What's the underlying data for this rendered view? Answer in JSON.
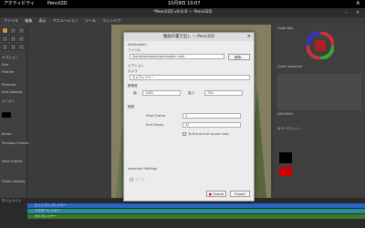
{
  "topbar": {
    "activities": "アクティビティ",
    "app": "Pencil2D",
    "clock": "10月9日 10:07",
    "tray": "A"
  },
  "window": {
    "title": "*Pencil2D v0.6.6 — Pencil2D"
  },
  "menu": [
    "ファイル",
    "編集",
    "表示",
    "アニメーション",
    "ツール",
    "ウィンドウ",
    "ヘルプ"
  ],
  "left": {
    "options": "オプション",
    "size_label": "Size",
    "feather_label": "Feather",
    "pressure_label": "Pressure",
    "anti_label": "Anti-Aliasing",
    "onion_label": "オニオン",
    "brush_label": "Brush",
    "previous_frames": "Previous Frames",
    "next_frames": "Next Frames",
    "opacity_label": "Onion Opacity"
  },
  "timeline": {
    "label": "タイムライン",
    "layers": [
      "ビットマップレイヤー",
      "ベクターレイヤー",
      "カメラレイヤー"
    ]
  },
  "right": {
    "color_wheel": "Color Box",
    "inspector": "Color Inspector",
    "palette": "カラーパレット",
    "hex": "#000000"
  },
  "dialog": {
    "title": "動画の書き出し — Pencil2D",
    "destination": "Destination",
    "file_label": "ファイル",
    "file_value": "/home/daisuke/myanimation.mp4",
    "browse": "参照...",
    "options": "オプション",
    "camera_label": "カメラ",
    "camera_value": "カメラレイヤー",
    "resolution": "解像度",
    "width_label": "幅",
    "width_value": "1280",
    "height_label": "高さ",
    "height_value": "720",
    "range": "範囲",
    "start_label": "Start Frame",
    "start_value": "1",
    "end_label": "End Frame",
    "end_value": "47",
    "sound_label": "To the end of sound clips",
    "gif_label": "Imported Settings",
    "loop_label": "ループ",
    "cancel": "Cancel",
    "export": "Export"
  }
}
